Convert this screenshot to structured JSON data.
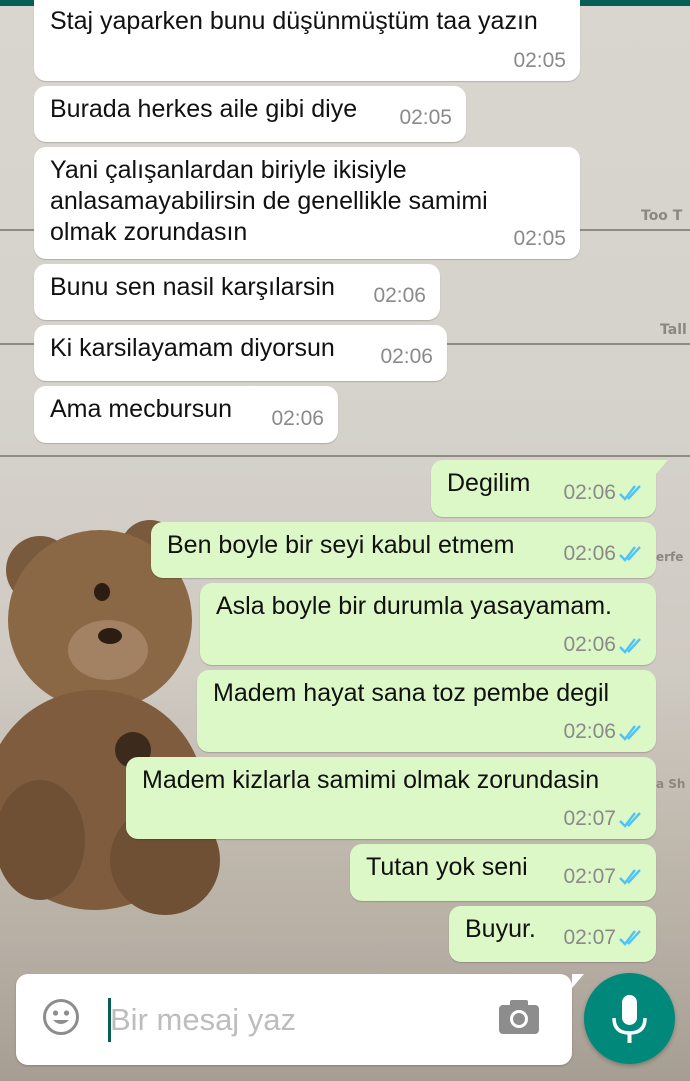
{
  "colors": {
    "incoming_bubble": "#ffffff",
    "outgoing_bubble": "#dcf8c6",
    "read_ticks": "#4fc3f7",
    "accent": "#00897b",
    "header": "#075e54"
  },
  "wallpaper": {
    "labels": [
      "Too T",
      "Tall",
      "erfe",
      "a Sh"
    ]
  },
  "messages": [
    {
      "direction": "in",
      "text": "Staj yaparken bunu düşünmüştüm taa yazın",
      "time": "02:05"
    },
    {
      "direction": "in",
      "text": "Burada herkes aile gibi diye",
      "time": "02:05"
    },
    {
      "direction": "in",
      "text": "Yani çalışanlardan biriyle ikisiyle anlasamayabilirsin de genellikle samimi olmak zorundasın",
      "time": "02:05"
    },
    {
      "direction": "in",
      "text": "Bunu sen nasil karşılarsin",
      "time": "02:06"
    },
    {
      "direction": "in",
      "text": "Ki karsilayamam diyorsun",
      "time": "02:06"
    },
    {
      "direction": "in",
      "text": "Ama mecbursun",
      "time": "02:06"
    },
    {
      "direction": "out",
      "text": "Degilim",
      "time": "02:06",
      "status": "read"
    },
    {
      "direction": "out",
      "text": "Ben boyle bir seyi kabul etmem",
      "time": "02:06",
      "status": "read"
    },
    {
      "direction": "out",
      "text": "Asla boyle bir durumla yasayamam.",
      "time": "02:06",
      "status": "read"
    },
    {
      "direction": "out",
      "text": "Madem hayat sana toz pembe degil",
      "time": "02:06",
      "status": "read"
    },
    {
      "direction": "out",
      "text": "Madem kizlarla samimi olmak zorundasin",
      "time": "02:07",
      "status": "read"
    },
    {
      "direction": "out",
      "text": "Tutan yok seni",
      "time": "02:07",
      "status": "read"
    },
    {
      "direction": "out",
      "text": "Buyur.",
      "time": "02:07",
      "status": "read"
    }
  ],
  "composer": {
    "placeholder": "Bir mesaj yaz",
    "value": "",
    "emoji_icon": "smiley-icon",
    "camera_icon": "camera-icon",
    "send_icon": "microphone-icon"
  }
}
